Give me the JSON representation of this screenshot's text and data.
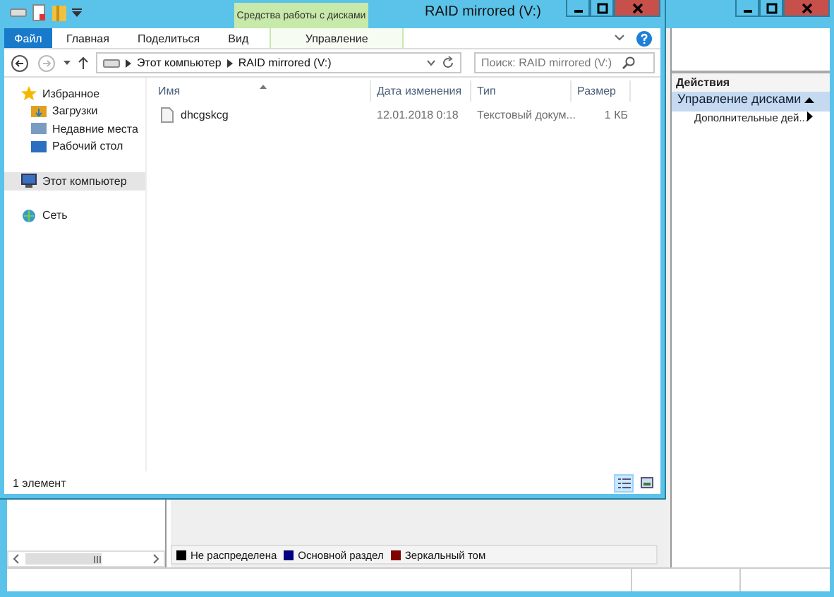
{
  "disk_window": {
    "actions": {
      "header": "Действия",
      "section": {
        "title": "Управление дисками",
        "expanded": true
      },
      "items": [
        {
          "label": "Дополнительные дей..."
        }
      ]
    },
    "legend": [
      {
        "label": "Не распределена",
        "color": "#000000"
      },
      {
        "label": "Основной раздел",
        "color": "#00007f"
      },
      {
        "label": "Зеркальный том",
        "color": "#7f0000"
      }
    ]
  },
  "explorer": {
    "title": "RAID mirrored (V:)",
    "context_group": "Средства работы с дисками",
    "tabs": [
      {
        "label": "Файл",
        "kind": "file",
        "selected": false
      },
      {
        "label": "Главная",
        "kind": "normal",
        "selected": false
      },
      {
        "label": "Поделиться",
        "kind": "normal",
        "selected": false
      },
      {
        "label": "Вид",
        "kind": "normal",
        "selected": false
      },
      {
        "label": "Управление",
        "kind": "contextual",
        "selected": false
      }
    ],
    "address": [
      "Этот компьютер",
      "RAID mirrored (V:)"
    ],
    "search": {
      "placeholder": "Поиск: RAID mirrored (V:)"
    },
    "navigation": [
      {
        "label": "Избранное",
        "kind": "favorites",
        "selected": false,
        "children": [
          {
            "label": "Загрузки",
            "kind": "downloads",
            "selected": false
          },
          {
            "label": "Недавние места",
            "kind": "recent",
            "selected": false
          },
          {
            "label": "Рабочий стол",
            "kind": "desktop",
            "selected": false
          }
        ]
      },
      {
        "label": "Этот компьютер",
        "kind": "computer",
        "selected": true
      },
      {
        "label": "Сеть",
        "kind": "network",
        "selected": false
      }
    ],
    "columns": [
      "Имя",
      "Дата изменения",
      "Тип",
      "Размер"
    ],
    "rows": [
      {
        "name": "dhcgskcg",
        "date": "12.01.2018 0:18",
        "type": "Текстовый докум...",
        "size": "1 КБ",
        "selected": false
      }
    ],
    "status": "1 элемент",
    "views": [
      {
        "kind": "details",
        "selected": true
      },
      {
        "kind": "tiles",
        "selected": false
      }
    ]
  }
}
